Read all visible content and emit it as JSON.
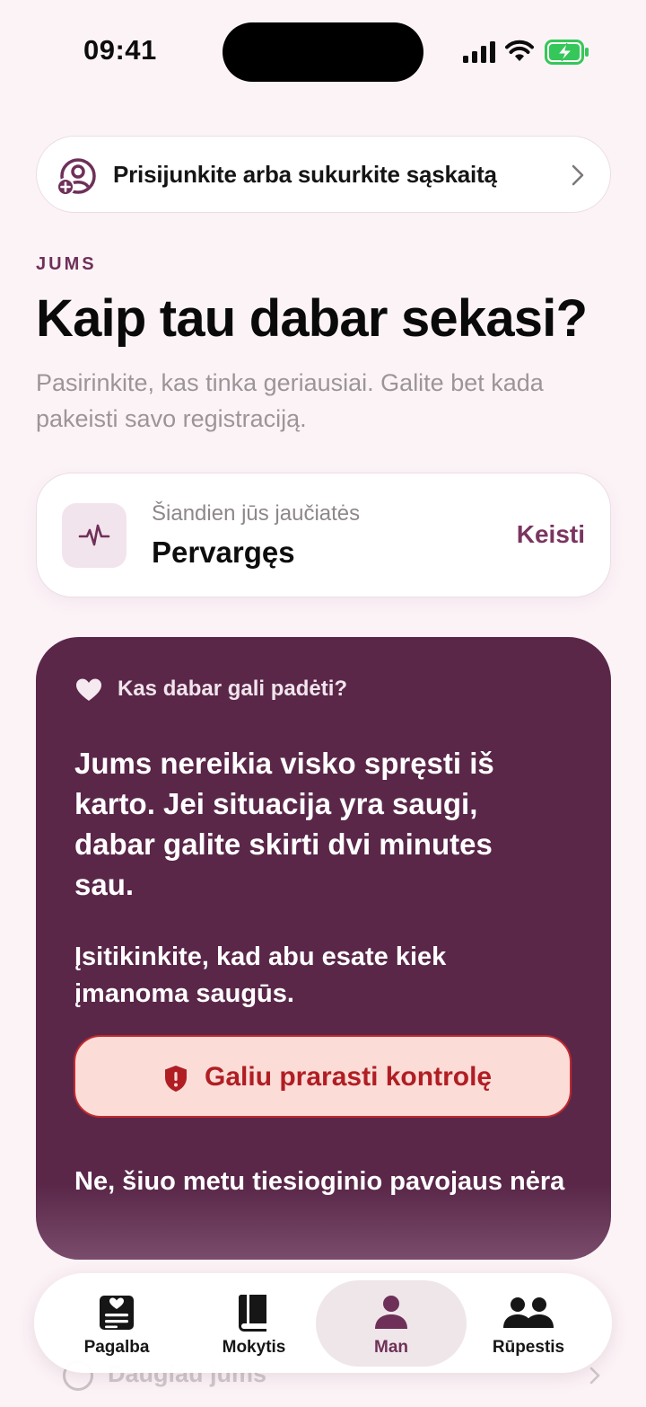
{
  "status_bar": {
    "time": "09:41",
    "icons": [
      "cellular-signal-icon",
      "wifi-icon",
      "battery-charging-icon"
    ],
    "battery_color": "#35c759"
  },
  "signin": {
    "label": "Prisijunkite arba sukurkite sąskaitą",
    "icon": "add-user-icon"
  },
  "section": {
    "eyebrow": "JUMS",
    "title": "Kaip tau dabar sekasi?",
    "subtitle": "Pasirinkite, kas tinka geriausiai. Galite bet kada pakeisti savo registraciją."
  },
  "mood": {
    "label": "Šiandien jūs jaučiatės",
    "value": "Pervargęs",
    "change_label": "Keisti",
    "icon": "heartbeat-icon"
  },
  "help": {
    "heading": "Kas dabar gali padėti?",
    "message": "Jums nereikia visko spręsti iš karto. Jei situacija yra saugi, dabar galite skirti dvi minutes sau.",
    "safety_note": "Įsitikinkite, kad abu esate kiek įmanoma saugūs.",
    "danger_button_label": "Galiu prarasti kontrolę",
    "no_danger_label": "Ne, šiuo metu tiesioginio pavojaus nėra"
  },
  "more_row": {
    "label": "Daugiau jums"
  },
  "tabs": [
    {
      "label": "Pagalba",
      "icon": "help-card-icon",
      "active": false
    },
    {
      "label": "Mokytis",
      "icon": "book-icon",
      "active": false
    },
    {
      "label": "Man",
      "icon": "person-icon",
      "active": true
    },
    {
      "label": "Rūpestis",
      "icon": "people-icon",
      "active": false
    }
  ],
  "colors": {
    "background": "#fcf3f7",
    "accent": "#6e3058",
    "card_dark": "#5a2749",
    "danger": "#b01e24",
    "danger_bg": "#fbdcd7"
  }
}
